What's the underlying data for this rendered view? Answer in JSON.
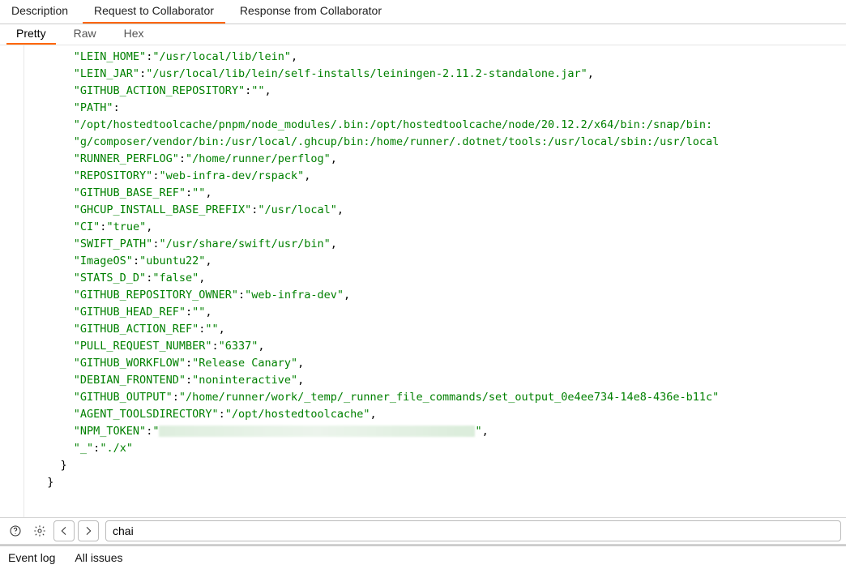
{
  "tabs": {
    "items": [
      {
        "label": "Description",
        "active": false
      },
      {
        "label": "Request to Collaborator",
        "active": true
      },
      {
        "label": "Response from Collaborator",
        "active": false
      }
    ]
  },
  "subtabs": {
    "items": [
      {
        "label": "Pretty",
        "active": true
      },
      {
        "label": "Raw",
        "active": false
      },
      {
        "label": "Hex",
        "active": false
      }
    ]
  },
  "json_lines": [
    {
      "indent": 3,
      "key": "LEIN_HOME",
      "value": "/usr/local/lib/lein",
      "comma": true
    },
    {
      "indent": 3,
      "key": "LEIN_JAR",
      "value": "/usr/local/lib/lein/self-installs/leiningen-2.11.2-standalone.jar",
      "comma": true
    },
    {
      "indent": 3,
      "key": "GITHUB_ACTION_REPOSITORY",
      "value": "",
      "comma": true
    },
    {
      "indent": 3,
      "key": "PATH",
      "value_continues": true
    },
    {
      "indent": 3,
      "raw_value": "/opt/hostedtoolcache/pnpm/node_modules/.bin:/opt/hostedtoolcache/node/20.12.2/x64/bin:/snap/bin:",
      "overflow": true
    },
    {
      "indent": 3,
      "raw_value": "g/composer/vendor/bin:/usr/local/.ghcup/bin:/home/runner/.dotnet/tools:/usr/local/sbin:/usr/local",
      "overflow": true
    },
    {
      "indent": 3,
      "key": "RUNNER_PERFLOG",
      "value": "/home/runner/perflog",
      "comma": true
    },
    {
      "indent": 3,
      "key": "REPOSITORY",
      "value": "web-infra-dev/rspack",
      "comma": true
    },
    {
      "indent": 3,
      "key": "GITHUB_BASE_REF",
      "value": "",
      "comma": true
    },
    {
      "indent": 3,
      "key": "GHCUP_INSTALL_BASE_PREFIX",
      "value": "/usr/local",
      "comma": true
    },
    {
      "indent": 3,
      "key": "CI",
      "value": "true",
      "comma": true
    },
    {
      "indent": 3,
      "key": "SWIFT_PATH",
      "value": "/usr/share/swift/usr/bin",
      "comma": true
    },
    {
      "indent": 3,
      "key": "ImageOS",
      "value": "ubuntu22",
      "comma": true
    },
    {
      "indent": 3,
      "key": "STATS_D_D",
      "value": "false",
      "comma": true
    },
    {
      "indent": 3,
      "key": "GITHUB_REPOSITORY_OWNER",
      "value": "web-infra-dev",
      "comma": true
    },
    {
      "indent": 3,
      "key": "GITHUB_HEAD_REF",
      "value": "",
      "comma": true
    },
    {
      "indent": 3,
      "key": "GITHUB_ACTION_REF",
      "value": "",
      "comma": true
    },
    {
      "indent": 3,
      "key": "PULL_REQUEST_NUMBER",
      "value": "6337",
      "comma": true
    },
    {
      "indent": 3,
      "key": "GITHUB_WORKFLOW",
      "value": "Release Canary",
      "comma": true
    },
    {
      "indent": 3,
      "key": "DEBIAN_FRONTEND",
      "value": "noninteractive",
      "comma": true
    },
    {
      "indent": 3,
      "key": "GITHUB_OUTPUT",
      "value": "/home/runner/work/_temp/_runner_file_commands/set_output_0e4ee734-14e8-436e-b11c",
      "overflow": true
    },
    {
      "indent": 3,
      "key": "AGENT_TOOLSDIRECTORY",
      "value": "/opt/hostedtoolcache",
      "comma": true
    },
    {
      "indent": 3,
      "key": "NPM_TOKEN",
      "redacted": true,
      "comma": true
    },
    {
      "indent": 3,
      "key": "_",
      "value": "./x",
      "comma": false
    },
    {
      "indent": 2,
      "close": "}"
    },
    {
      "indent": 1,
      "close": "}"
    }
  ],
  "search": {
    "value": "chai"
  },
  "footer": {
    "event_log": "Event log",
    "all_issues": "All issues"
  }
}
